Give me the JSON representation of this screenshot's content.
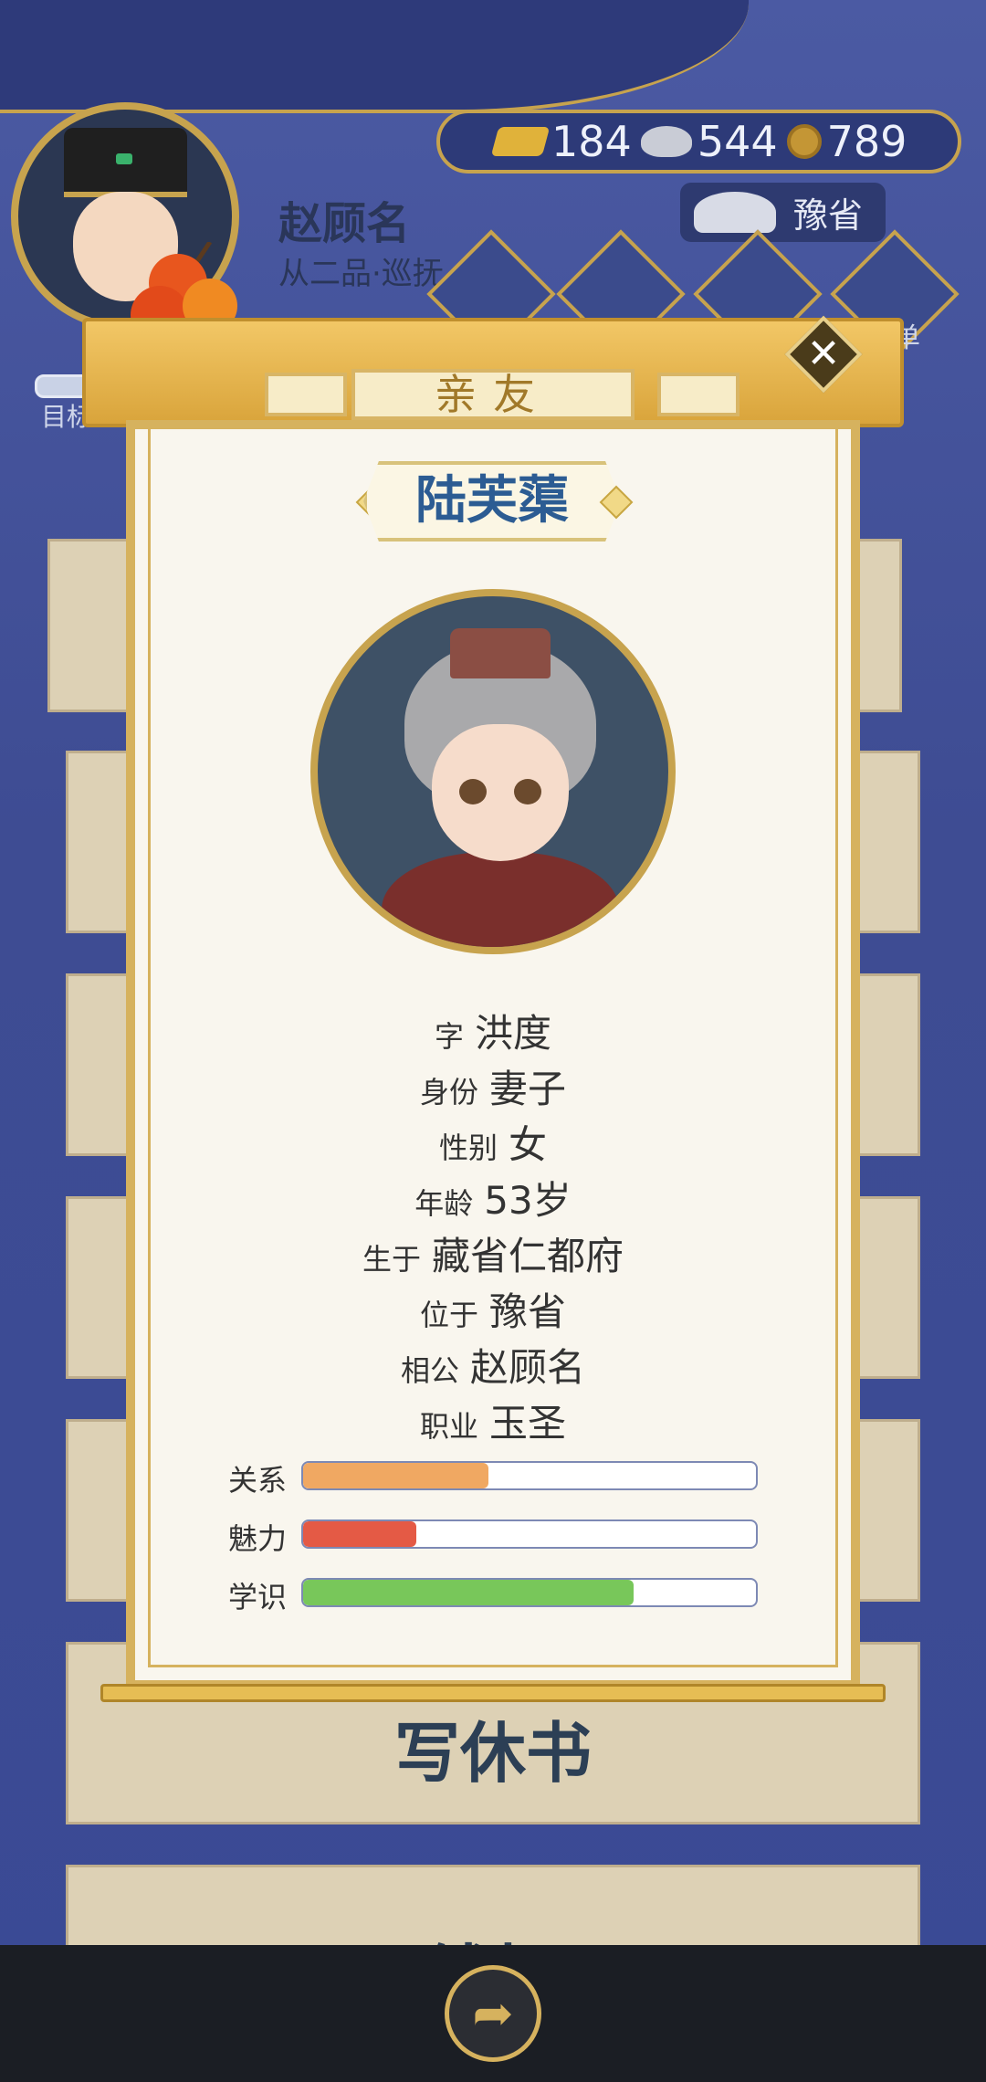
{
  "player": {
    "name": "赵顾名",
    "rank": "从二品·巡抚",
    "goal_label": "目标"
  },
  "currency": {
    "gold": "184",
    "silver": "544",
    "copper": "789"
  },
  "location": "豫省",
  "top_menu": {
    "partial_label": "单"
  },
  "background_cards": {
    "divorce": "写休书",
    "money_chest": "钱柜"
  },
  "modal": {
    "title": "亲友",
    "person_name": "陆芙蕖",
    "info": [
      {
        "key": "字",
        "value": "洪度"
      },
      {
        "key": "身份",
        "value": "妻子"
      },
      {
        "key": "性别",
        "value": "女"
      },
      {
        "key": "年龄",
        "value": "53岁"
      },
      {
        "key": "生于",
        "value": "藏省仁都府"
      },
      {
        "key": "位于",
        "value": "豫省"
      },
      {
        "key": "相公",
        "value": "赵顾名"
      },
      {
        "key": "职业",
        "value": "玉圣"
      }
    ],
    "stats": [
      {
        "label": "关系",
        "fraction": 0.41,
        "color": "#f0a862"
      },
      {
        "label": "魅力",
        "fraction": 0.25,
        "color": "#e45a45"
      },
      {
        "label": "学识",
        "fraction": 0.73,
        "color": "#78c75a"
      }
    ]
  },
  "icons": [
    "gold-ingot-icon",
    "silver-ingot-icon",
    "copper-coin-icon",
    "close-icon",
    "share-icon"
  ]
}
